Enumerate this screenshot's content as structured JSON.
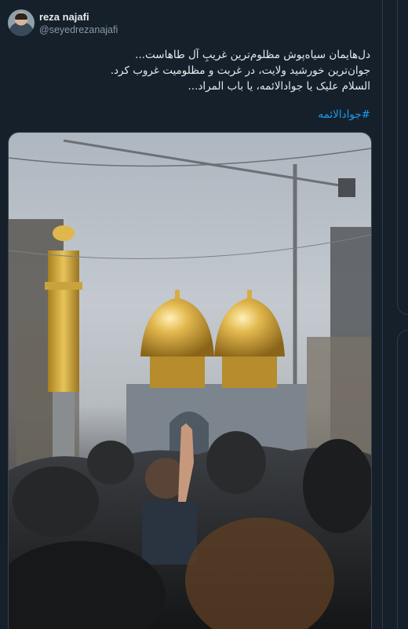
{
  "tweet": {
    "author_name": "reza najafi",
    "author_handle": "@seyedrezanajafi",
    "text_lines": [
      "دل‌هایمان سیاه‌پوش مظلوم‌ترین غریبِ آل طاهاست...",
      "جوان‌ترین خورشید ولایت، در غربت و مظلومیت غروب کرد.",
      "السلام علیک یا جوادالائمه، یا باب المراد..."
    ],
    "hashtag": "#جوادالائمه"
  },
  "colors": {
    "background": "#15202b",
    "text": "#e7e9ea",
    "secondary_text": "#8b98a5",
    "link": "#1d9bf0"
  },
  "icons": {
    "avatar": "profile-photo"
  }
}
